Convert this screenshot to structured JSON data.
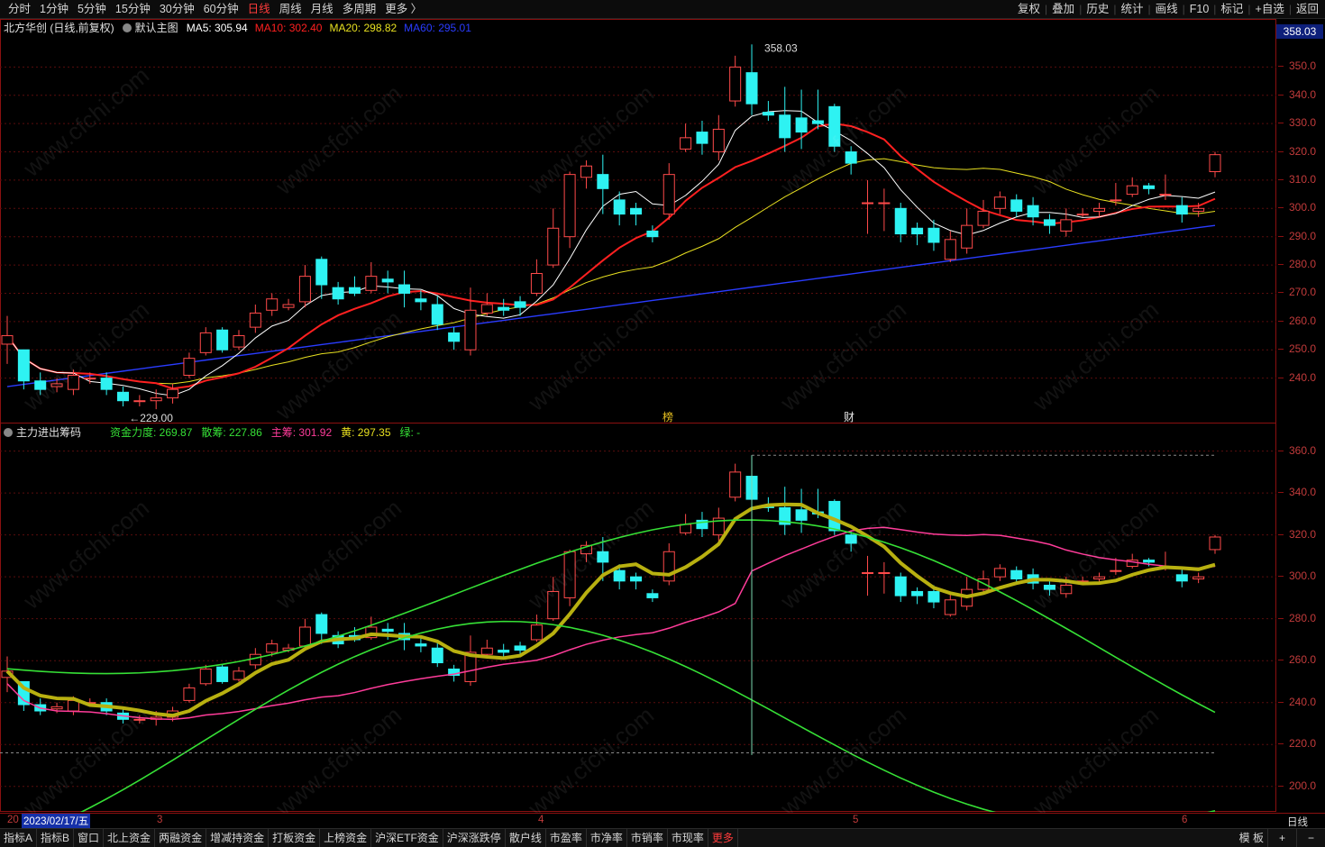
{
  "top_tabs": [
    "分时",
    "1分钟",
    "5分钟",
    "15分钟",
    "30分钟",
    "60分钟",
    "日线",
    "周线",
    "月线",
    "多周期",
    "更多 〉"
  ],
  "active_tab": "日线",
  "tools": [
    "复权",
    "叠加",
    "历史",
    "统计",
    "画线",
    "F10",
    "标记",
    "+自选",
    "返回"
  ],
  "main_panel": {
    "title": "北方华创 (日线,前复权)",
    "indicator": "默认主图",
    "ma": [
      {
        "label": "MA5: 305.94",
        "color": "#ffffff"
      },
      {
        "label": "MA10: 302.40",
        "color": "#ff2020"
      },
      {
        "label": "MA20: 298.82",
        "color": "#e8e020"
      },
      {
        "label": "MA60: 295.01",
        "color": "#2a3cff"
      }
    ],
    "current_price": "358.03",
    "high_label": "358.03",
    "low_label": "229.00",
    "flags": [
      "榜",
      "财"
    ],
    "y_ticks": [
      "350.0",
      "340.0",
      "330.0",
      "320.0",
      "310.0",
      "300.0",
      "290.0",
      "280.0",
      "270.0",
      "260.0",
      "250.0",
      "240.0"
    ]
  },
  "sub_panel": {
    "title": "主力进出筹码",
    "items": [
      {
        "label": "资金力度: 269.87",
        "color": "#36e036"
      },
      {
        "label": "散筹: 227.86",
        "color": "#36e036"
      },
      {
        "label": "主筹: 301.92",
        "color": "#ff3c9a"
      },
      {
        "label": "黄: 297.35",
        "color": "#e8e020"
      },
      {
        "label": "绿: -",
        "color": "#36e036"
      }
    ],
    "y_ticks": [
      "360.0",
      "340.0",
      "320.0",
      "300.0",
      "280.0",
      "260.0",
      "240.0",
      "220.0",
      "200.0"
    ]
  },
  "date_axis": {
    "first": "20",
    "cursor_date": "2023/02/17/五",
    "months": [
      "3",
      "4",
      "5",
      "6"
    ],
    "period": "日线"
  },
  "bottom_tabs": [
    "指标A",
    "指标B",
    "窗口",
    "北上资金",
    "两融资金",
    "增减持资金",
    "打板资金",
    "上榜资金",
    "沪深ETF资金",
    "沪深涨跌停",
    "散户线",
    "市盈率",
    "市净率",
    "市销率",
    "市现率",
    "更多"
  ],
  "bottom_right": [
    "模 板",
    "+",
    "−"
  ],
  "watermark": "www.cfchi.com",
  "chart_data": {
    "type": "candlestick",
    "dates_first": "2023/02/17",
    "candles": [
      [
        252,
        255,
        245,
        262
      ],
      [
        250,
        239,
        236,
        250
      ],
      [
        239,
        236,
        234,
        242
      ],
      [
        237,
        238,
        235,
        240
      ],
      [
        236,
        241,
        234,
        243
      ],
      [
        240,
        240,
        238,
        242
      ],
      [
        240,
        236,
        234,
        242
      ],
      [
        235,
        232,
        230,
        237
      ],
      [
        232,
        232,
        230,
        234
      ],
      [
        232,
        233,
        229,
        236
      ],
      [
        233,
        236,
        231,
        238
      ],
      [
        241,
        247,
        240,
        249
      ],
      [
        249,
        256,
        248,
        258
      ],
      [
        257,
        250,
        249,
        258
      ],
      [
        251,
        255,
        250,
        257
      ],
      [
        258,
        263,
        256,
        266
      ],
      [
        264,
        268,
        262,
        270
      ],
      [
        265,
        266,
        264,
        268
      ],
      [
        267,
        276,
        265,
        280
      ],
      [
        282,
        273,
        268,
        283
      ],
      [
        272,
        268,
        266,
        274
      ],
      [
        272,
        270,
        269,
        276
      ],
      [
        271,
        276,
        270,
        281
      ],
      [
        275,
        274,
        270,
        278
      ],
      [
        273,
        270,
        265,
        278
      ],
      [
        268,
        267,
        264,
        271
      ],
      [
        266,
        259,
        257,
        269
      ],
      [
        256,
        253,
        250,
        258
      ],
      [
        250,
        264,
        248,
        272
      ],
      [
        263,
        266,
        262,
        270
      ],
      [
        265,
        264,
        262,
        268
      ],
      [
        267,
        265,
        262,
        269
      ],
      [
        270,
        277,
        269,
        282
      ],
      [
        280,
        293,
        279,
        300
      ],
      [
        290,
        312,
        286,
        313
      ],
      [
        311,
        315,
        307,
        317
      ],
      [
        312,
        307,
        298,
        319
      ],
      [
        303,
        298,
        294,
        306
      ],
      [
        300,
        298,
        294,
        302
      ],
      [
        292,
        290,
        288,
        294
      ],
      [
        298,
        312,
        296,
        316
      ],
      [
        321,
        325,
        320,
        330
      ],
      [
        327,
        323,
        319,
        331
      ],
      [
        320,
        328,
        317,
        333
      ],
      [
        338,
        350,
        336,
        354
      ],
      [
        348,
        337,
        333,
        358
      ],
      [
        334,
        333,
        331,
        338
      ],
      [
        333,
        325,
        320,
        343
      ],
      [
        332,
        327,
        321,
        342
      ],
      [
        331,
        330,
        328,
        342
      ],
      [
        336,
        322,
        320,
        337
      ],
      [
        320,
        316,
        312,
        322
      ],
      [
        302,
        302,
        291,
        310
      ],
      [
        302,
        302,
        292,
        307
      ],
      [
        300,
        291,
        288,
        302
      ],
      [
        293,
        291,
        287,
        295
      ],
      [
        293,
        288,
        285,
        296
      ],
      [
        282,
        289,
        281,
        292
      ],
      [
        286,
        294,
        284,
        300
      ],
      [
        294,
        299,
        293,
        303
      ],
      [
        300,
        304,
        298,
        306
      ],
      [
        303,
        299,
        297,
        305
      ],
      [
        301,
        297,
        294,
        304
      ],
      [
        296,
        294,
        291,
        298
      ],
      [
        292,
        296,
        290,
        300
      ],
      [
        298,
        298,
        297,
        300
      ],
      [
        299,
        300,
        297,
        302
      ],
      [
        303,
        303,
        301,
        309
      ],
      [
        305,
        308,
        304,
        311
      ],
      [
        308,
        307,
        305,
        309
      ],
      [
        305,
        305,
        303,
        312
      ],
      [
        301,
        298,
        295,
        304
      ],
      [
        299,
        300,
        297,
        302
      ],
      [
        313,
        319,
        311,
        320
      ]
    ],
    "ma_labels": {
      "MA5": "305.94",
      "MA10": "302.40",
      "MA20": "298.82",
      "MA60": "295.01"
    },
    "main_ylim": [
      230,
      360
    ],
    "sub_ylim": [
      190,
      365
    ]
  }
}
